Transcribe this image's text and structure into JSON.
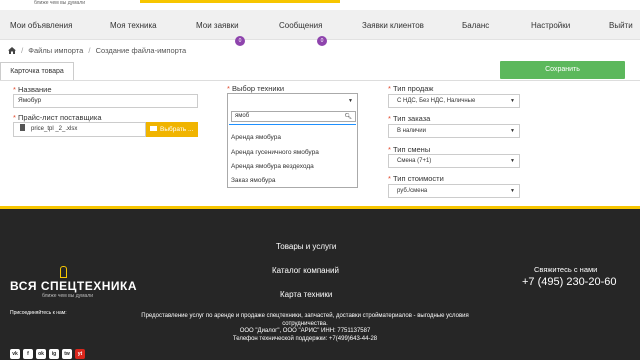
{
  "top_strip": {
    "tagline": "ближе чем вы думали"
  },
  "nav": {
    "items": [
      {
        "label": "Мои объявления"
      },
      {
        "label": "Моя техника"
      },
      {
        "label": "Мои заявки",
        "badge": "0"
      },
      {
        "label": "Сообщения",
        "badge": "0"
      },
      {
        "label": "Заявки клиентов"
      },
      {
        "label": "Баланс"
      },
      {
        "label": "Настройки"
      },
      {
        "label": "Выйти"
      }
    ]
  },
  "breadcrumb": {
    "items": [
      "Файлы импорта",
      "Создание файла-импорта"
    ]
  },
  "tabs": {
    "card": "Карточка товара"
  },
  "save_button": "Сохранить",
  "form": {
    "name": {
      "label": "Название",
      "value": "Ямобур"
    },
    "price_list": {
      "label": "Прайс-лист поставщика",
      "file": "price_tpl _2_.xlsx",
      "choose": "Выбрать ..."
    },
    "equipment": {
      "label": "Выбор техники",
      "search": "ямоб",
      "options": [
        "Аренда ямобура",
        "Аренда гусеничного ямобура",
        "Аренда ямобура вездехода",
        "Заказ ямобура"
      ]
    },
    "sale_type": {
      "label": "Тип продаж",
      "value": "С НДС, Без НДС, Наличные"
    },
    "order_type": {
      "label": "Тип заказа",
      "value": "В наличии"
    },
    "shift_type": {
      "label": "Тип смены",
      "value": "Смена (7+1)"
    },
    "cost_type": {
      "label": "Тип стоимости",
      "value": "руб./смена"
    }
  },
  "footer": {
    "links": [
      "Товары и услуги",
      "Каталог компаний",
      "Карта техники"
    ],
    "logo": "ВСЯ СПЕЦТЕХНИКА",
    "logo_tagline": "ближе чем вы думали",
    "contact_title": "Свяжитесь с нами",
    "phone": "+7 (495) 230-20-60",
    "description_1": "Предоставление услуг по аренде и продаже спецтехники, запчастей, доставки стройматериалов - выгодные условия сотрудничества.",
    "description_2": "ООО \"Диалог\", ООО \"АРИС\" ИНН: 7751137587",
    "description_3": "Телефон технической поддержки: +7(499)643-44-28",
    "join": "Присоединяйтесь к нам:",
    "socials": [
      "vk",
      "f",
      "ok",
      "ig",
      "tw",
      "yt"
    ]
  },
  "colors": {
    "accent_yellow": "#f7c600",
    "save_green": "#5cb85c",
    "badge_purple": "#8e44ad",
    "footer_bg": "#262626"
  }
}
